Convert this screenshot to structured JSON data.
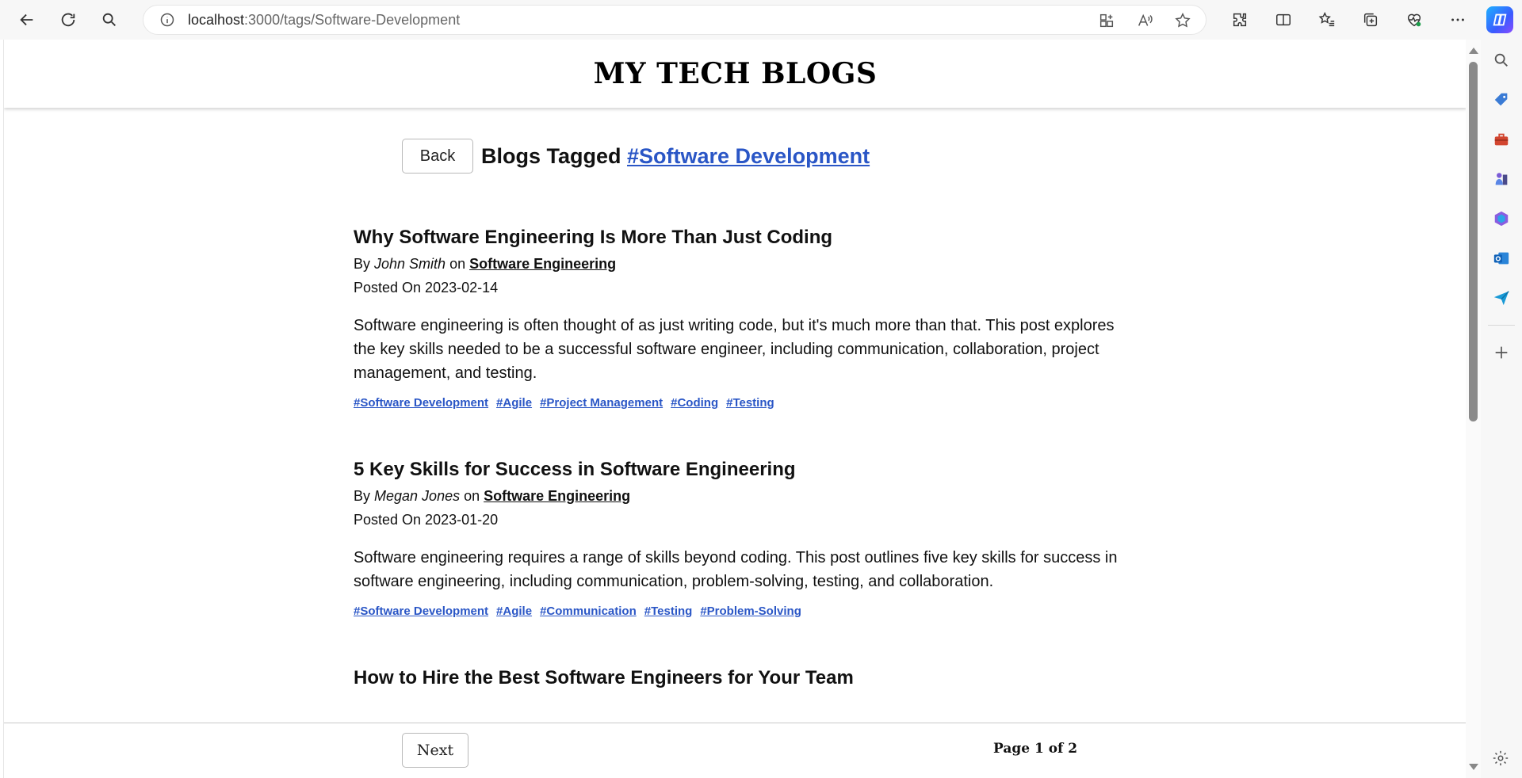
{
  "browser": {
    "url_host": "localhost",
    "url_path": ":3000/tags/Software-Development"
  },
  "site": {
    "title": "MY TECH BLOGS"
  },
  "tag_page": {
    "back_label": "Back",
    "heading_prefix": "Blogs Tagged ",
    "tag_link": "#Software Development"
  },
  "posts": [
    {
      "title": "Why Software Engineering Is More Than Just Coding",
      "by": "By ",
      "author": "John Smith",
      "on": " on ",
      "category": "Software Engineering",
      "posted": "Posted On 2023-02-14",
      "excerpt": "Software engineering is often thought of as just writing code, but it's much more than that. This post explores the key skills needed to be a successful software engineer, including communication, collaboration, project management, and testing.",
      "tags": [
        "#Software Development",
        "#Agile",
        "#Project Management",
        "#Coding",
        "#Testing"
      ]
    },
    {
      "title": "5 Key Skills for Success in Software Engineering",
      "by": "By ",
      "author": "Megan Jones",
      "on": " on ",
      "category": "Software Engineering",
      "posted": "Posted On 2023-01-20",
      "excerpt": "Software engineering requires a range of skills beyond coding. This post outlines five key skills for success in software engineering, including communication, problem-solving, testing, and collaboration.",
      "tags": [
        "#Software Development",
        "#Agile",
        "#Communication",
        "#Testing",
        "#Problem-Solving"
      ]
    },
    {
      "title": "How to Hire the Best Software Engineers for Your Team"
    }
  ],
  "pagination": {
    "next_label": "Next",
    "page_text": "Page 1 of 2"
  },
  "colors": {
    "link_blue": "#2a56c6",
    "text": "#111111"
  }
}
